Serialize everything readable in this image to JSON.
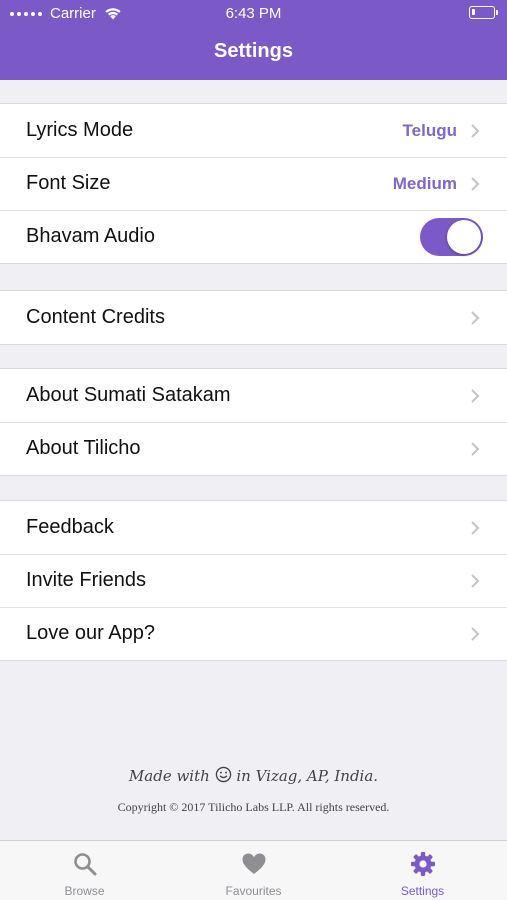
{
  "status_bar": {
    "carrier": "Carrier",
    "time": "6:43 PM"
  },
  "nav": {
    "title": "Settings"
  },
  "groups": [
    [
      {
        "label": "Lyrics Mode",
        "value": "Telugu"
      },
      {
        "label": "Font Size",
        "value": "Medium"
      },
      {
        "label": "Bhavam Audio",
        "toggle_on": true
      }
    ],
    [
      {
        "label": "Content Credits"
      }
    ],
    [
      {
        "label": "About Sumati Satakam"
      },
      {
        "label": "About Tilicho"
      }
    ],
    [
      {
        "label": "Feedback"
      },
      {
        "label": "Invite Friends"
      },
      {
        "label": "Love our App?"
      }
    ]
  ],
  "footer": {
    "tagline_pre": "Made with",
    "tagline_icon": "smiley-icon",
    "tagline_post": "in Vizag, AP, India.",
    "copyright": "Copyright © 2017 Tilicho Labs LLP. All rights reserved."
  },
  "tabs": [
    {
      "label": "Browse",
      "icon": "search-icon",
      "active": false
    },
    {
      "label": "Favourites",
      "icon": "heart-icon",
      "active": false
    },
    {
      "label": "Settings",
      "icon": "gear-icon",
      "active": true
    }
  ],
  "colors": {
    "accent": "#7b5ac8",
    "value_text": "#8068c4",
    "background": "#efeff4",
    "inactive_tab": "#8e8e93"
  }
}
